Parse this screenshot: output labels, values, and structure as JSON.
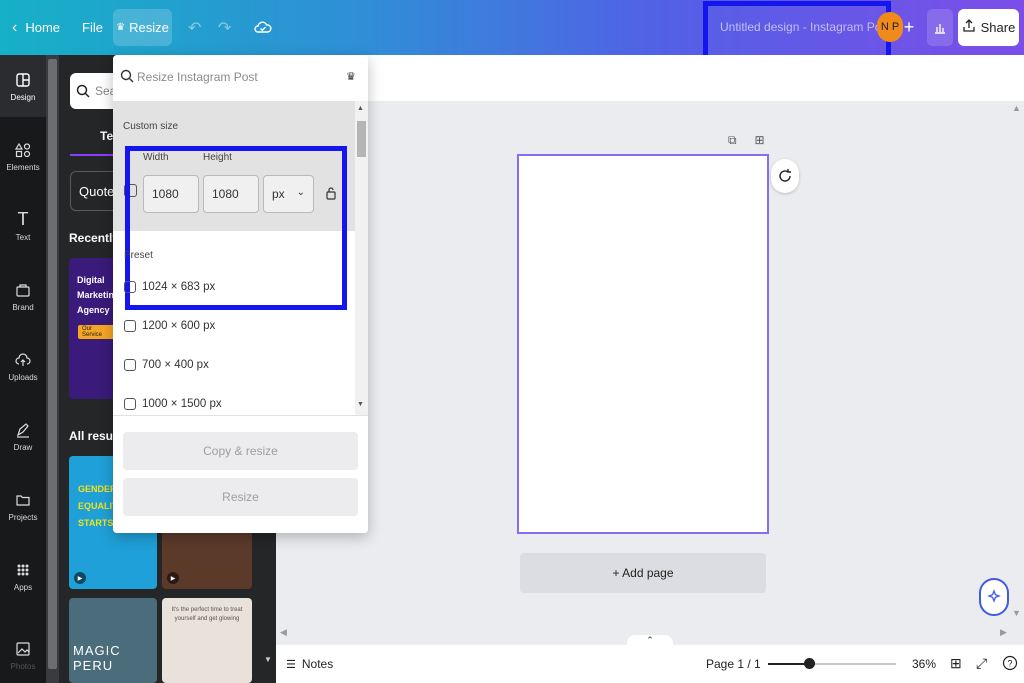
{
  "topbar": {
    "home_label": "Home",
    "file_label": "File",
    "resize_label": "Resize",
    "design_title": "Untitled design - Instagram Post",
    "avatar_initials": "N P",
    "share_label": "Share"
  },
  "rail": {
    "items": [
      {
        "label": "Design",
        "icon": "design-icon"
      },
      {
        "label": "Elements",
        "icon": "elements-icon"
      },
      {
        "label": "Text",
        "icon": "text-icon"
      },
      {
        "label": "Brand",
        "icon": "brand-icon"
      },
      {
        "label": "Uploads",
        "icon": "uploads-icon"
      },
      {
        "label": "Draw",
        "icon": "draw-icon"
      },
      {
        "label": "Projects",
        "icon": "projects-icon"
      },
      {
        "label": "Apps",
        "icon": "apps-icon"
      },
      {
        "label": "Photos",
        "icon": "photos-icon"
      }
    ]
  },
  "sidepanel": {
    "search_placeholder": "Sear",
    "tab_label": "Te",
    "chip_label": "Quote",
    "recently_used": "Recently u",
    "all_results": "All results",
    "thumb1_text": "Digital Marketin Agency",
    "thumb1_pill": "Our Service",
    "thumb2_text": "GENDER EQUALITY STARTS WI YOU",
    "thumb4_text": "MAGIC PERU",
    "thumb5_text": "It's the perfect time to treat yourself and get glowing"
  },
  "resize_popover": {
    "search_placeholder": "Resize Instagram Post",
    "custom_size_label": "Custom size",
    "width_label": "Width",
    "height_label": "Height",
    "width_value": "1080",
    "height_value": "1080",
    "unit": "px",
    "preset_label": "Preset",
    "presets": [
      "1024 × 683 px",
      "1200 × 600 px",
      "700 × 400 px",
      "1000 × 1500 px"
    ],
    "copy_resize_label": "Copy & resize",
    "resize_label": "Resize"
  },
  "canvas": {
    "add_page_label": "+ Add page"
  },
  "bottombar": {
    "notes_label": "Notes",
    "page_indicator": "Page 1 / 1",
    "zoom_label": "36%",
    "zoom_fraction": 0.32
  },
  "colors": {
    "accent": "#8b3dff",
    "highlight_box": "#1515f0",
    "topbar_start": "#16b0c7",
    "topbar_end": "#7b4ee8"
  }
}
